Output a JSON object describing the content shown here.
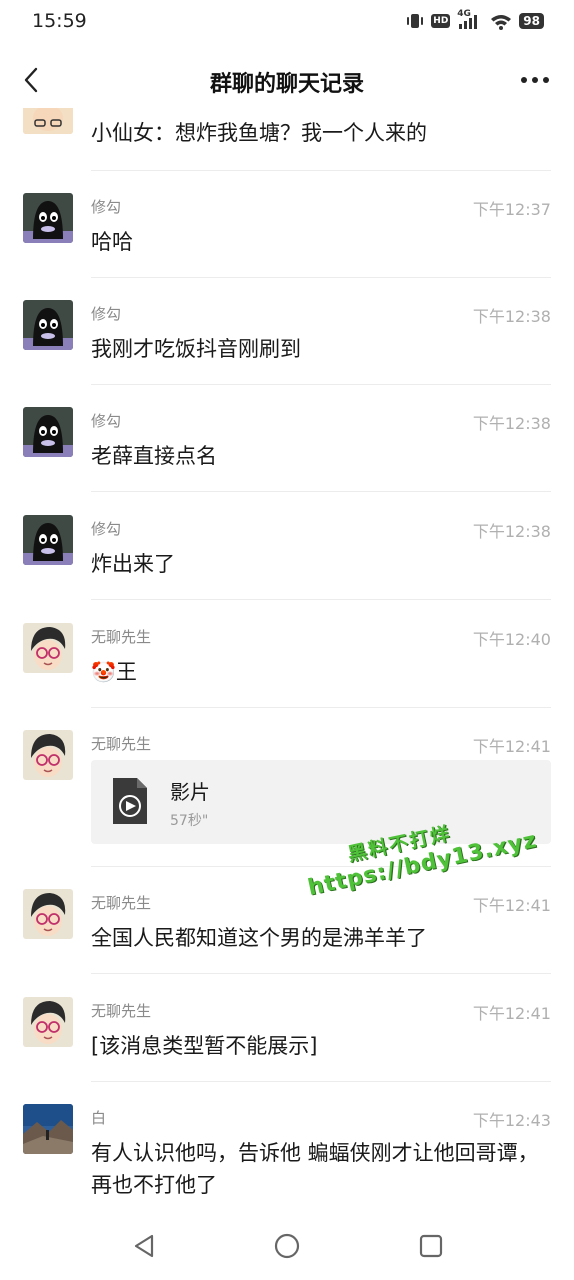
{
  "status_bar": {
    "time": "15:59",
    "hd_label": "HD",
    "network": "4G",
    "battery": "98"
  },
  "header": {
    "title": "群聊的聊天记录"
  },
  "messages": [
    {
      "sender": "",
      "time": "",
      "text": "小仙女：想炸我鱼塘？我一个人来的",
      "avatar": "girl-avatar"
    },
    {
      "sender": "修勾",
      "time": "下午12:37",
      "text": "哈哈",
      "avatar": "dark-cartoon-avatar"
    },
    {
      "sender": "修勾",
      "time": "下午12:38",
      "text": "我刚才吃饭抖音刚刷到",
      "avatar": "dark-cartoon-avatar"
    },
    {
      "sender": "修勾",
      "time": "下午12:38",
      "text": "老薛直接点名",
      "avatar": "dark-cartoon-avatar"
    },
    {
      "sender": "修勾",
      "time": "下午12:38",
      "text": "炸出来了",
      "avatar": "dark-cartoon-avatar"
    },
    {
      "sender": "无聊先生",
      "time": "下午12:40",
      "text": "王",
      "emoji": "🤡",
      "avatar": "glasses-man-avatar"
    },
    {
      "sender": "无聊先生",
      "time": "下午12:41",
      "file": {
        "name": "影片",
        "duration": "57秒\""
      },
      "avatar": "glasses-man-avatar"
    },
    {
      "sender": "无聊先生",
      "time": "下午12:41",
      "text": "全国人民都知道这个男的是沸羊羊了",
      "avatar": "glasses-man-avatar"
    },
    {
      "sender": "无聊先生",
      "time": "下午12:41",
      "text": "[该消息类型暂不能展示]",
      "avatar": "glasses-man-avatar"
    },
    {
      "sender": "白",
      "time": "下午12:43",
      "text": "有人认识他吗，告诉他 蝙蝠侠刚才让他回哥谭，再也不打他了",
      "avatar": "landscape-avatar"
    }
  ],
  "watermark": {
    "line1": "黑料不打烊",
    "line2": "https://bdy13.xyz"
  },
  "colors": {
    "watermark": "#4fc23a",
    "divider": "#ececec",
    "file_card_bg": "#f2f2f2"
  }
}
